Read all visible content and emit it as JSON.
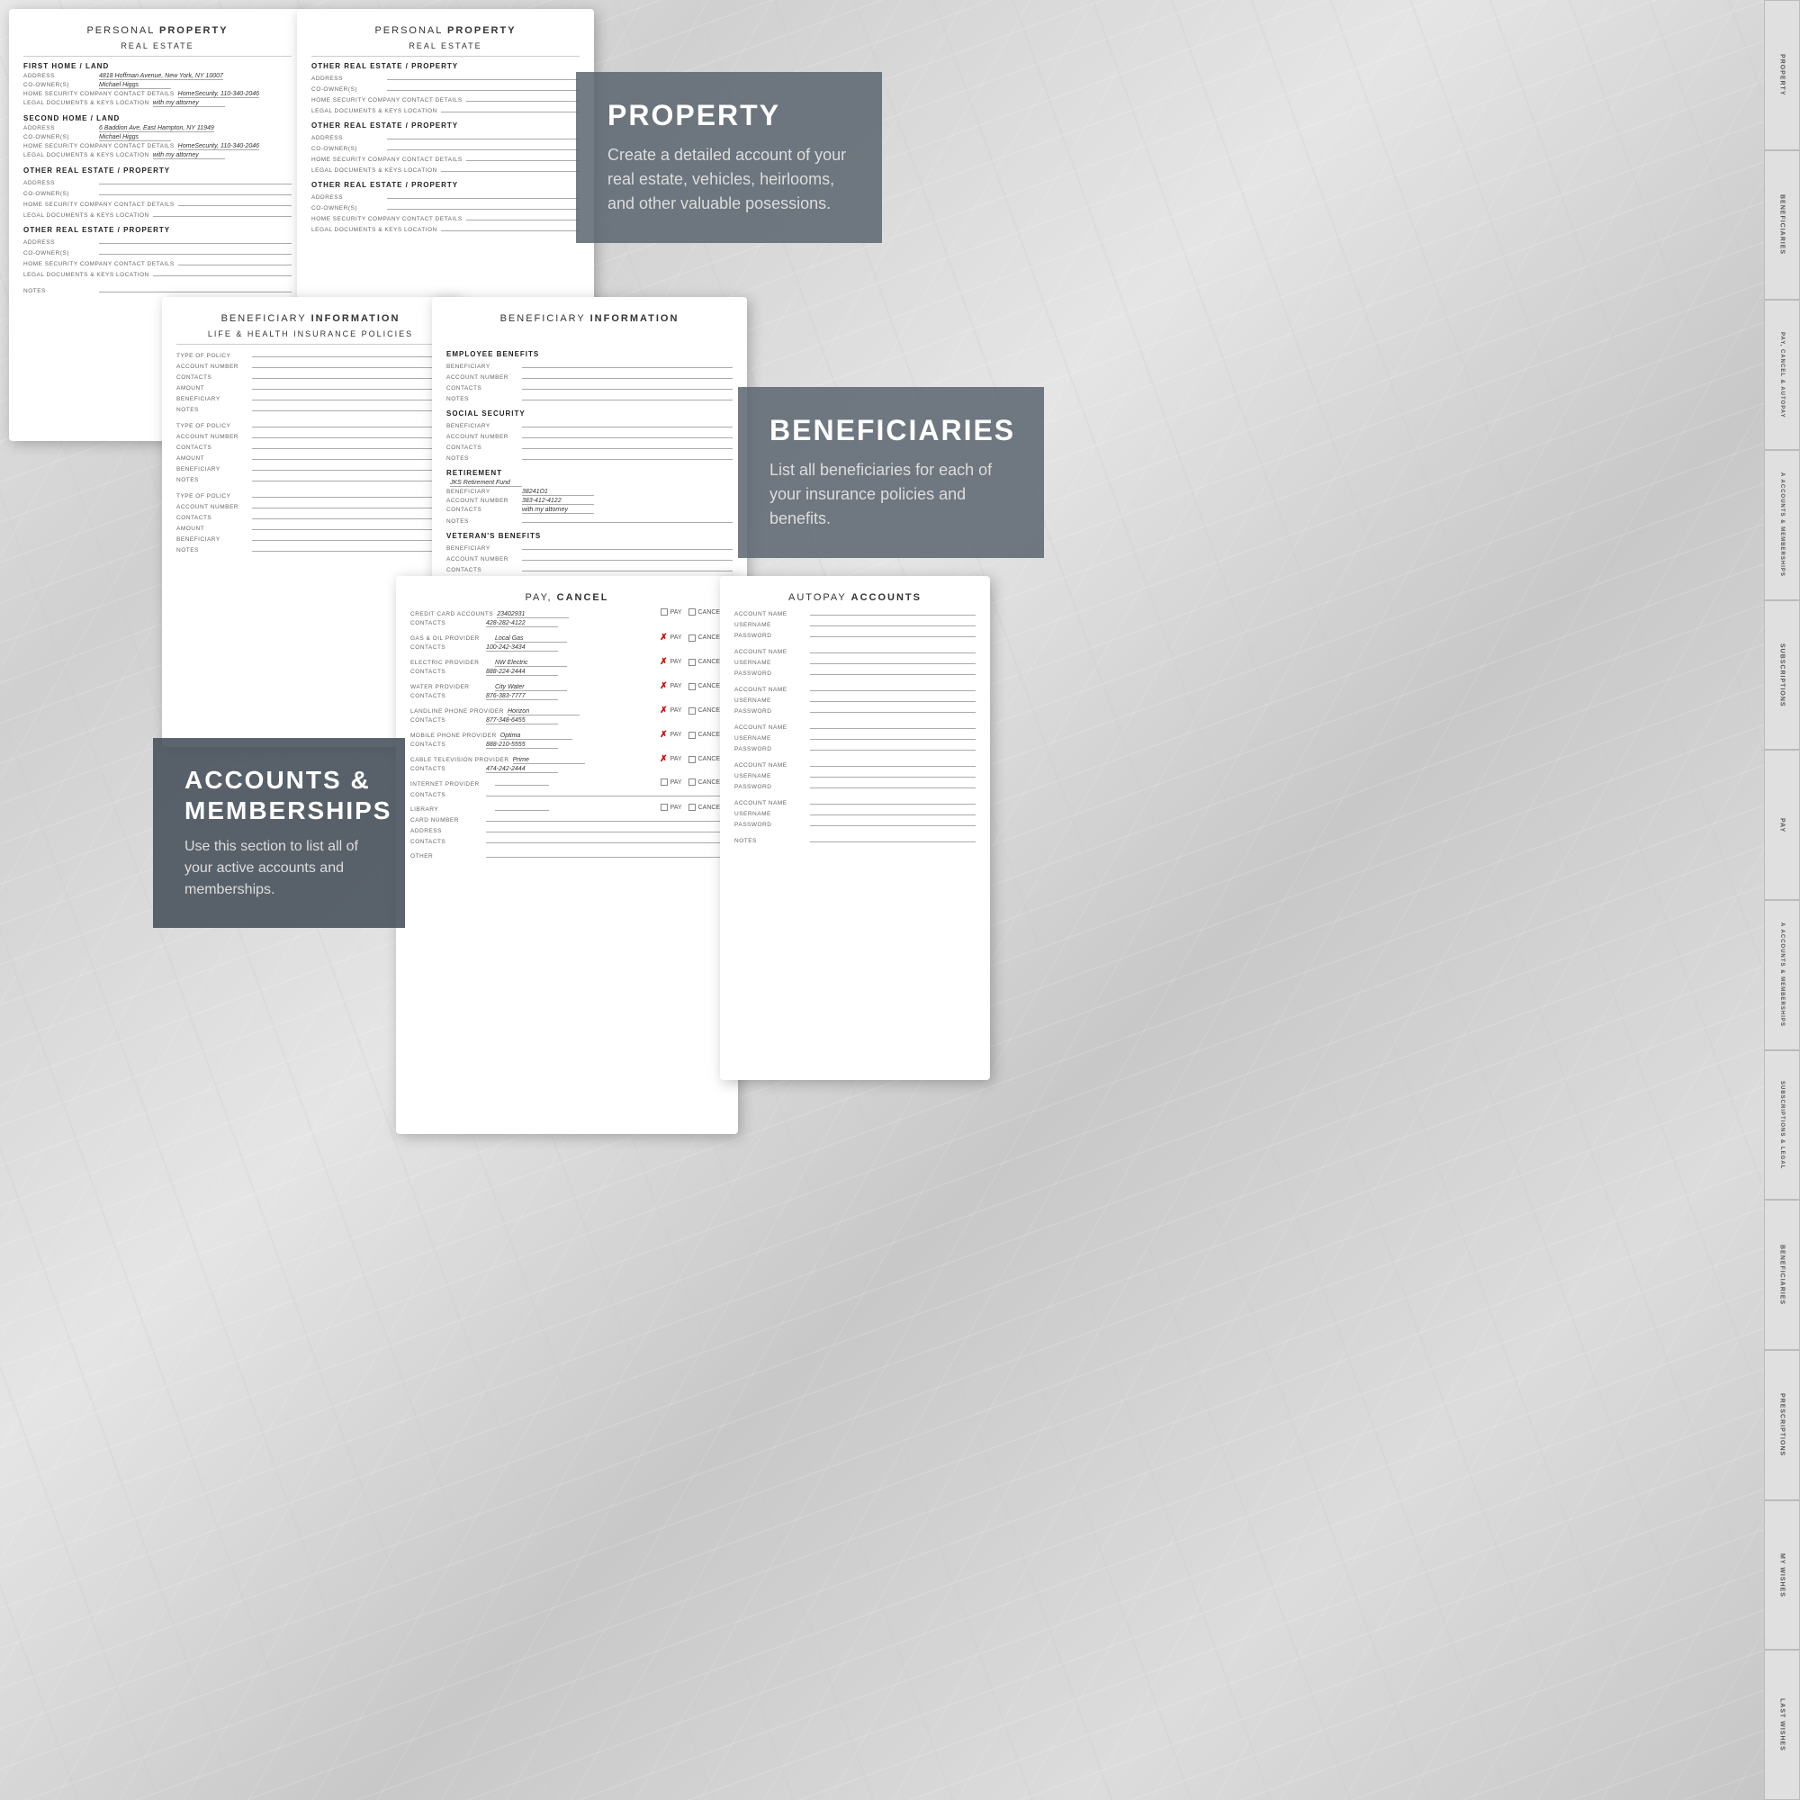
{
  "property_card_1": {
    "title": "PERSONAL",
    "title_bold": "PROPERTY",
    "subtitle": "REAL ESTATE",
    "section1_header": "FIRST HOME / LAND",
    "addr_label": "ADDRESS",
    "addr_value": "4818 Hoffman Avenue, New York, NY 10007",
    "coowner_label": "CO-OWNER(S)",
    "coowner_value": "Michael Higgs",
    "security_label": "HOME SECURITY COMPANY CONTACT DETAILS",
    "security_value": "HomeSecurity, 110-340-2046",
    "legal_label": "LEGAL DOCUMENTS & KEYS LOCATION",
    "legal_value": "with my attorney",
    "section2_header": "SECOND HOME / LAND",
    "addr2_value": "6 Baddion Ave, East Hampton, NY 11949",
    "coowner2_value": "Michael Higgs",
    "security2_value": "HomeSecurity, 110-340-2046",
    "legal2_value": "with my attorney",
    "section3_header": "OTHER REAL ESTATE / PROPERTY",
    "addr3_label": "ADDRESS",
    "coowner3_label": "CO-OWNER(S)",
    "security3_label": "HOME SECURITY COMPANY CONTACT DETAILS",
    "legal3_label": "LEGAL DOCUMENTS & KEYS LOCATION",
    "section4_header": "OTHER REAL ESTATE / PROPERTY",
    "addr4_label": "ADDRESS",
    "coowner4_label": "CO-OWNER(S)",
    "security4_label": "HOME SECURITY COMPANY CONTACT DETAILS",
    "legal4_label": "LEGAL DOCUMENTS & KEYS LOCATION",
    "notes_label": "NOTES"
  },
  "property_card_2": {
    "title": "PERSONAL",
    "title_bold": "PROPERTY",
    "subtitle": "REAL ESTATE",
    "section1_header": "OTHER REAL ESTATE / PROPERTY",
    "addr_label": "ADDRESS",
    "coowner_label": "CO-OWNER(S)",
    "security_label": "HOME SECURITY COMPANY CONTACT DETAILS",
    "legal_label": "LEGAL DOCUMENTS & KEYS LOCATION",
    "section2_header": "OTHER REAL ESTATE / PROPERTY",
    "section3_header": "OTHER REAL ESTATE / PROPERTY"
  },
  "property_info": {
    "heading": "PROPERTY",
    "body": "Create a detailed account of your real estate, vehicles, heirlooms, and other valuable posessions."
  },
  "beneficiary_card_1": {
    "title": "BENEFICIARY",
    "title_bold": "INFORMATION",
    "subtitle": "LIFE & HEALTH INSURANCE POLICIES",
    "fields": [
      "TYPE OF POLICY",
      "ACCOUNT NUMBER",
      "CONTACTS",
      "AMOUNT",
      "BENEFICIARY",
      "NOTES"
    ],
    "fields2": [
      "TYPE OF POLICY",
      "ACCOUNT NUMBER",
      "CONTACTS",
      "AMOUNT",
      "BENEFICIARY",
      "NOTES"
    ],
    "fields3": [
      "TYPE OF POLICY",
      "ACCOUNT NUMBER",
      "CONTACTS",
      "AMOUNT",
      "BENEFICIARY",
      "NOTES"
    ]
  },
  "beneficiary_card_2": {
    "title": "BENEFICIARY",
    "title_bold": "INFORMATION",
    "section1": "EMPLOYEE BENEFITS",
    "emp_fields": [
      "BENEFICIARY",
      "ACCOUNT NUMBER",
      "CONTACTS",
      "NOTES"
    ],
    "section2": "SOCIAL SECURITY",
    "ss_fields": [
      "BENEFICIARY",
      "ACCOUNT NUMBER",
      "CONTACTS",
      "NOTES"
    ],
    "section3": "RETIREMENT",
    "ret_value": "JKS Retirement Fund",
    "ret_beneficiary": "38241O1",
    "ret_account": "383-412-4122",
    "ret_contacts": "with my attorney",
    "ret_notes_label": "NOTES",
    "section4": "VETERAN'S BENEFITS",
    "vet_fields": [
      "BENEFICIARY",
      "ACCOUNT NUMBER",
      "CONTACTS"
    ]
  },
  "beneficiary_info": {
    "heading": "BENEFICIARIES",
    "body": "List all beneficiaries for each of your insurance policies and benefits."
  },
  "pay_cancel_card": {
    "title": "PAY,",
    "title_bold": "CANCEL",
    "rows": [
      {
        "label": "CREDIT CARD ACCOUNTS",
        "value": "23402931",
        "contacts_label": "CONTACTS",
        "contacts_value": "428-282-4122",
        "pay": false,
        "cancel": false
      },
      {
        "label": "GAS & OIL PROVIDER",
        "value": "Local Gas",
        "contacts_label": "CONTACTS",
        "contacts_value": "100-242-3434",
        "pay": true,
        "cancel": false
      },
      {
        "label": "ELECTRIC PROVIDER",
        "value": "NW Electric",
        "contacts_label": "CONTACTS",
        "contacts_value": "888-224-2444",
        "pay": true,
        "cancel": false
      },
      {
        "label": "WATER PROVIDER",
        "value": "City Water",
        "contacts_label": "CONTACTS",
        "contacts_value": "876-383-7777",
        "pay": true,
        "cancel": false
      },
      {
        "label": "LANDLINE PHONE PROVIDER",
        "value": "Horizon",
        "contacts_label": "CONTACTS",
        "contacts_value": "877-348-6455",
        "pay": true,
        "cancel": false
      },
      {
        "label": "MOBILE PHONE PROVIDER",
        "value": "Optima",
        "contacts_label": "CONTACTS",
        "contacts_value": "888-210-5555",
        "pay": true,
        "cancel": false
      },
      {
        "label": "CABLE TELEVISION PROVIDER",
        "value": "Prime",
        "contacts_label": "CONTACTS",
        "contacts_value": "474-242-2444",
        "pay": true,
        "cancel": false
      },
      {
        "label": "INTERNET PROVIDER",
        "value": "",
        "contacts_label": "CONTACTS",
        "contacts_value": "",
        "pay": false,
        "cancel": false
      },
      {
        "label": "LIBRARY",
        "value": "",
        "contacts_label": "CARD NUMBER",
        "contacts_value": "",
        "pay": false,
        "cancel": false,
        "extra_fields": [
          "ADDRESS",
          "CONTACTS"
        ]
      },
      {
        "label": "OTHER",
        "value": ""
      }
    ],
    "pay_label": "PAY",
    "cancel_label": "CANCEL"
  },
  "autopay_card": {
    "title": "AUTOPAY",
    "title_bold": "ACCOUNTS",
    "fields": [
      "ACCOUNT NAME",
      "USERNAME",
      "PASSWORD"
    ],
    "num_sections": 6,
    "notes_label": "NOTES"
  },
  "accounts_info": {
    "heading": "ACCOUNTS &\nMEMBERSHIPS",
    "body": "Use this section to list all of your active accounts and memberships."
  },
  "right_tabs": [
    "PROPERTY",
    "BENEFICIARIES",
    "PAY, CANCEL & AUTOPAY",
    "A ACCOUNTS & MEMBERSHIPS",
    "SUBSCRIPTIONS",
    "PAY",
    "A ACCOUNTS & MEMBERSHIPS",
    "SUBSCRIPTIONS & LEGAL",
    "BENEFICIARIES",
    "PRESCRIPTIONS",
    "MY WISHES",
    "LAST WISHES"
  ]
}
